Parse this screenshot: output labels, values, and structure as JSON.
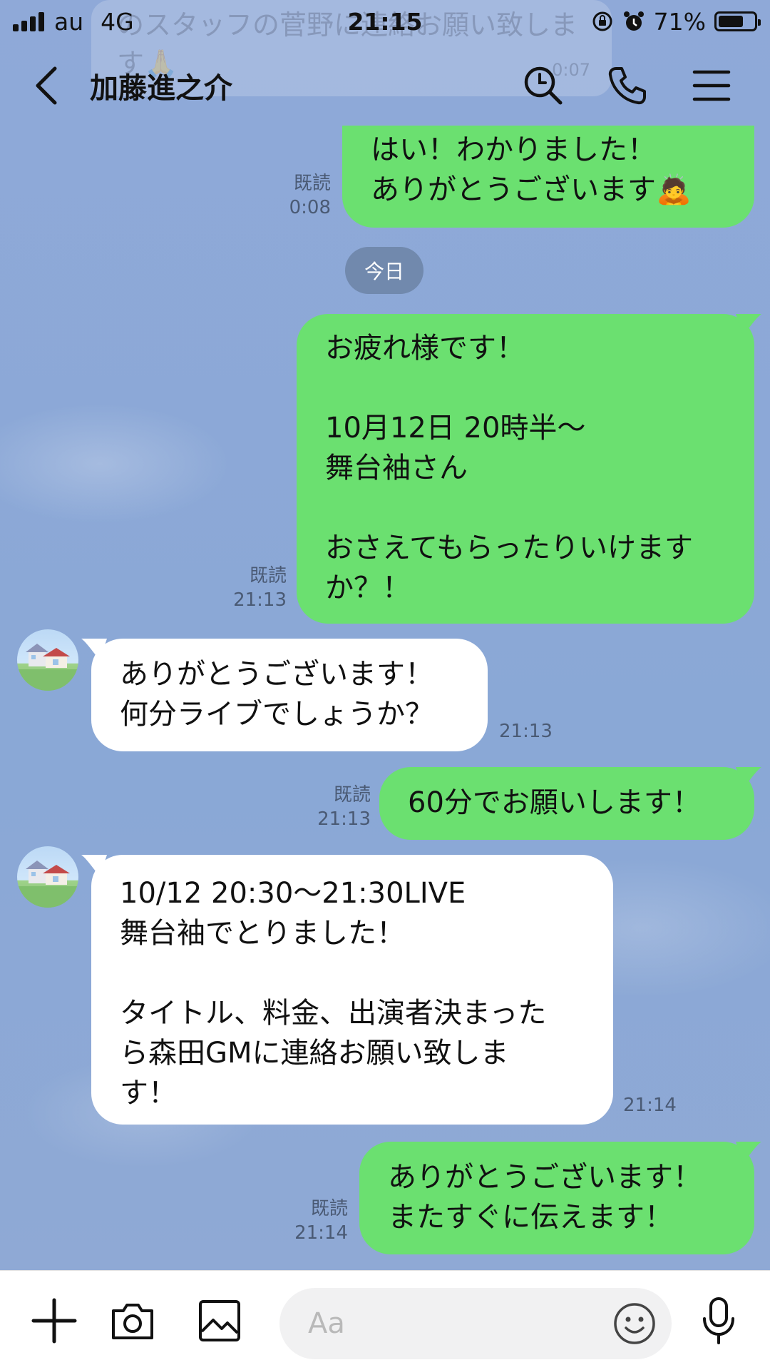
{
  "status_bar": {
    "carrier": "au",
    "network": "4G",
    "time": "21:15",
    "battery_percent": "71%",
    "battery_level": 0.71
  },
  "ghost_banner": {
    "text": "のスタッフの菅野に連絡お願い致します🙏",
    "time": "0:07"
  },
  "header": {
    "title": "加藤進之介",
    "icons": [
      "back-arrow-icon",
      "search-icon",
      "phone-icon",
      "menu-icon"
    ]
  },
  "date_divider": "今日",
  "messages": [
    {
      "side": "sent",
      "text": "はい！わかりました！\nありがとうございます🙇",
      "read": "既読",
      "time": "0:08"
    },
    {
      "side": "sent",
      "text": "お疲れ様です！\n\n10月12日 20時半〜\n舞台袖さん\n\nおさえてもらったりいけます\nか？！",
      "read": "既読",
      "time": "21:13"
    },
    {
      "side": "received",
      "text": "ありがとうございます！\n何分ライブでしょうか？",
      "time": "21:13"
    },
    {
      "side": "sent",
      "text": "60分でお願いします！",
      "read": "既読",
      "time": "21:13"
    },
    {
      "side": "received",
      "text": "10/12 20:30〜21:30LIVE\n舞台袖でとりました！\n\nタイトル、料金、出演者決まった\nら森田GMに連絡お願い致しま\nす！",
      "time": "21:14"
    },
    {
      "side": "sent",
      "text": "ありがとうございます！\nまたすぐに伝えます！",
      "read": "既読",
      "time": "21:14"
    }
  ],
  "input_bar": {
    "placeholder": "Aa",
    "icons": [
      "plus-icon",
      "camera-icon",
      "image-icon",
      "emoji-icon",
      "microphone-icon"
    ]
  },
  "colors": {
    "chat_background": "#8da9d6",
    "sent_bubble": "#6be070",
    "received_bubble": "#ffffff",
    "date_chip": "#7189ad"
  }
}
